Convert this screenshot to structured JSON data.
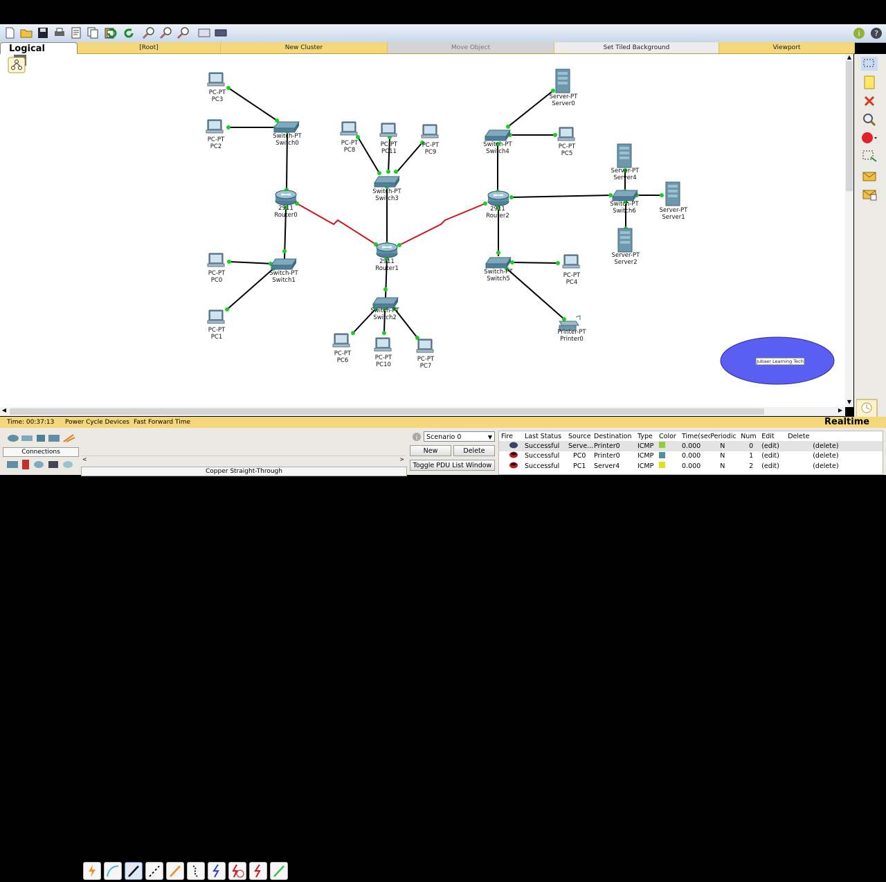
{
  "mode_bar": {
    "logical": "Logical",
    "root": "[Root]",
    "new_cluster": "New Cluster",
    "move_object": "Move Object",
    "tiled_background": "Set Tiled Background",
    "viewport": "Viewport"
  },
  "devices": {
    "pc3": {
      "type": "PC-PT",
      "name": "PC3"
    },
    "pc2": {
      "type": "PC-PT",
      "name": "PC2"
    },
    "pc0": {
      "type": "PC-PT",
      "name": "PC0"
    },
    "pc1": {
      "type": "PC-PT",
      "name": "PC1"
    },
    "pc8": {
      "type": "PC-PT",
      "name": "PC8"
    },
    "pc11": {
      "type": "PC-PT",
      "name": "PC11"
    },
    "pc9": {
      "type": "PC-PT",
      "name": "PC9"
    },
    "pc6": {
      "type": "PC-PT",
      "name": "PC6"
    },
    "pc10": {
      "type": "PC-PT",
      "name": "PC10"
    },
    "pc7": {
      "type": "PC-PT",
      "name": "PC7"
    },
    "pc5": {
      "type": "PC-PT",
      "name": "PC5"
    },
    "pc4": {
      "type": "PC-PT",
      "name": "PC4"
    },
    "switch0": {
      "type": "Switch-PT",
      "name": "Switch0"
    },
    "switch1": {
      "type": "Switch-PT",
      "name": "Switch1"
    },
    "switch2": {
      "type": "Switch-PT",
      "name": "Switch2"
    },
    "switch3": {
      "type": "Switch-PT",
      "name": "Switch3"
    },
    "switch4": {
      "type": "Switch-PT",
      "name": "Switch4"
    },
    "switch5": {
      "type": "Switch-PT",
      "name": "Switch5"
    },
    "switch6": {
      "type": "Switch-PT",
      "name": "Switch6"
    },
    "router0": {
      "type": "2911",
      "name": "Router0"
    },
    "router1": {
      "type": "2911",
      "name": "Router1"
    },
    "router2": {
      "type": "2911",
      "name": "Router2"
    },
    "server0": {
      "type": "Server-PT",
      "name": "Server0"
    },
    "server1": {
      "type": "Server-PT",
      "name": "Server1"
    },
    "server2": {
      "type": "Server-PT",
      "name": "Server2"
    },
    "server4": {
      "type": "Server-PT",
      "name": "Server4"
    },
    "printer0": {
      "type": "Printer-PT",
      "name": "Printer0"
    }
  },
  "note_label": "Jubaer Learning Tech",
  "status_bar": {
    "time": "Time: 00:37:13",
    "power_cycle": "Power Cycle Devices",
    "fast_forward": "Fast Forward Time",
    "realtime": "Realtime"
  },
  "connections": {
    "category_label": "Connections",
    "selected_cable": "Copper Straight-Through"
  },
  "scenario": {
    "selected": "Scenario 0",
    "new_button": "New",
    "delete_button": "Delete",
    "toggle_button": "Toggle PDU List Window"
  },
  "pdu_table": {
    "headers": [
      "Fire",
      "Last Status",
      "Source",
      "Destination",
      "Type",
      "Color",
      "Time(sec)",
      "Periodic",
      "Num",
      "Edit",
      "Delete"
    ],
    "rows": [
      {
        "status": "Successful",
        "source": "Serve...",
        "destination": "Printer0",
        "type": "ICMP",
        "color": "#8fce3a",
        "time": "0.000",
        "periodic": "N",
        "num": "0",
        "edit": "(edit)",
        "delete": "(delete)"
      },
      {
        "status": "Successful",
        "source": "PC0",
        "destination": "Printer0",
        "type": "ICMP",
        "color": "#4f8f95",
        "time": "0.000",
        "periodic": "N",
        "num": "1",
        "edit": "(edit)",
        "delete": "(delete)"
      },
      {
        "status": "Successful",
        "source": "PC1",
        "destination": "Server4",
        "type": "ICMP",
        "color": "#d7e41a",
        "time": "0.000",
        "periodic": "N",
        "num": "2",
        "edit": "(edit)",
        "delete": "(delete)"
      }
    ]
  },
  "colors": {
    "link": "#000000",
    "serial_link": "#d0161b",
    "port_up": "#19d11c",
    "note_fill": "#5b5ef2",
    "mode_bar": "#f3d77a"
  }
}
